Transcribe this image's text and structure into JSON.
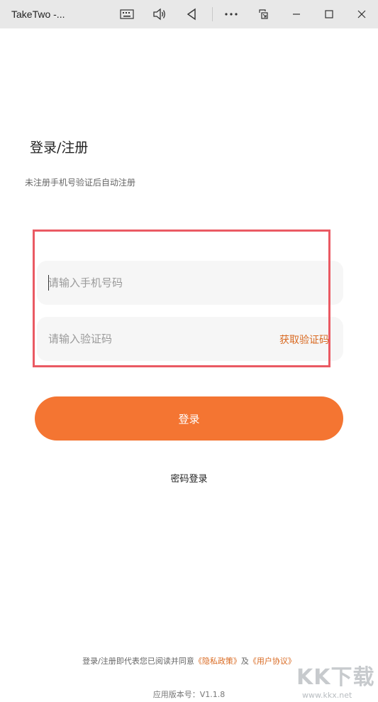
{
  "window": {
    "title": "TakeTwo -...",
    "icons": [
      "keyboard-icon",
      "volume-icon",
      "back-icon",
      "more-icon",
      "snap-icon",
      "minimize-icon",
      "maximize-icon",
      "close-icon"
    ]
  },
  "header": {
    "title": "登录/注册",
    "subtitle": "未注册手机号验证后自动注册"
  },
  "form": {
    "phone_placeholder": "请输入手机号码",
    "code_placeholder": "请输入验证码",
    "get_code_label": "获取验证码",
    "login_label": "登录",
    "password_login_label": "密码登录"
  },
  "footer": {
    "agree_prefix": "登录/注册即代表您已阅读并同意",
    "privacy_link": "《隐私政策》",
    "and_text": "及",
    "terms_link": "《用户协议》",
    "version": "应用版本号：V1.1.8"
  },
  "watermark": {
    "logo_text": "KK下载",
    "url": "www.kkx.net"
  },
  "colors": {
    "accent": "#f47532",
    "link": "#d96a22",
    "highlight_border": "#ea5a63",
    "field_bg": "#f6f6f6",
    "titlebar_bg": "#e8e8e8"
  }
}
